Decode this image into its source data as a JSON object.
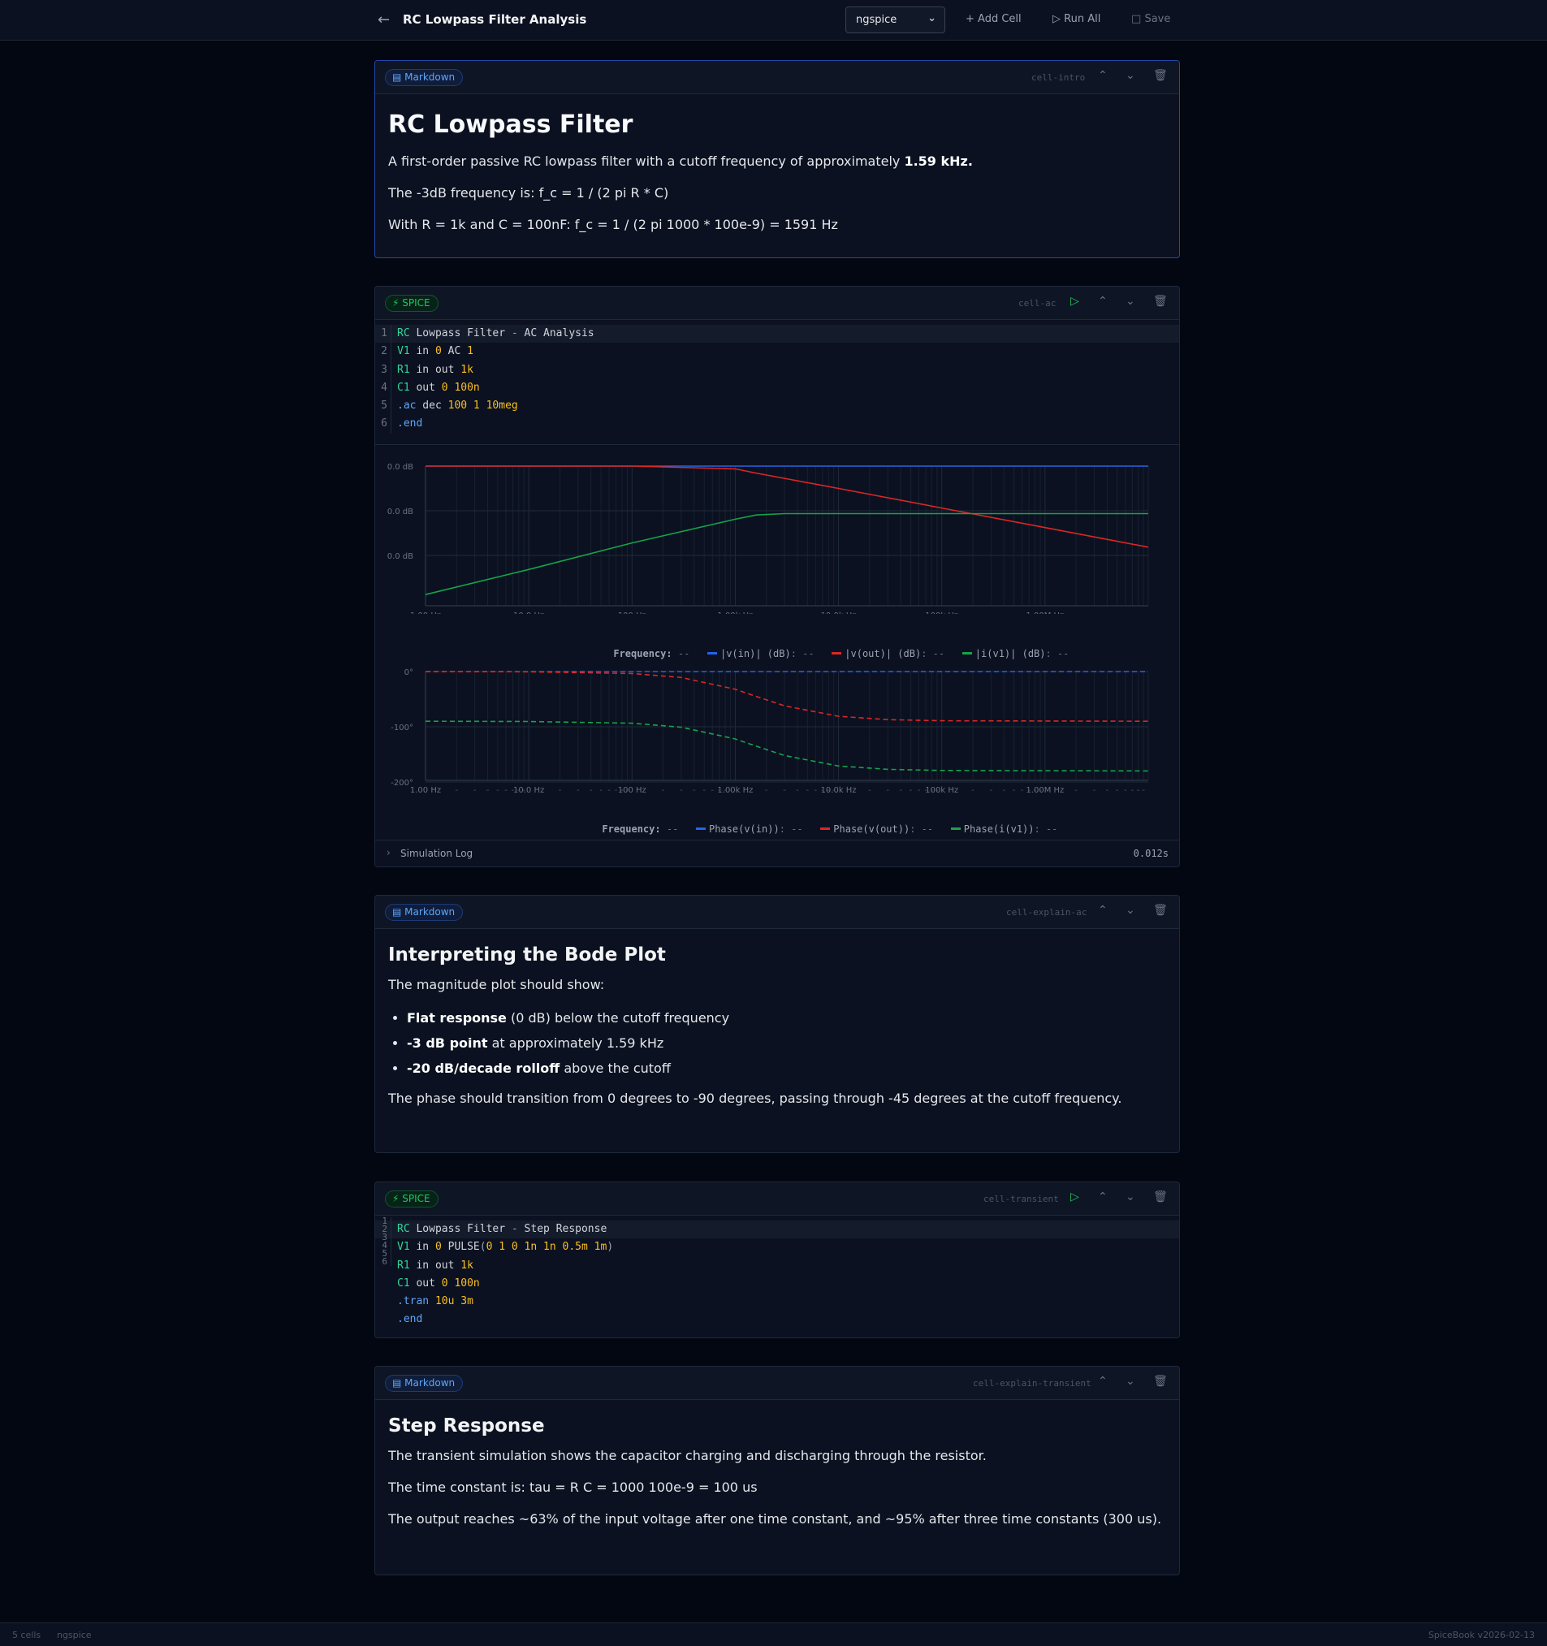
{
  "header": {
    "back_icon": "arrow-left-icon",
    "title": "RC Lowpass Filter Analysis",
    "engine_select": "ngspice",
    "add_cell": "Add Cell",
    "run_all": "Run All",
    "save": "Save"
  },
  "cells": {
    "intro": {
      "type": "Markdown",
      "id": "cell-intro",
      "h1": "RC Lowpass Filter",
      "p1_pre": "A first-order passive RC lowpass filter with a cutoff frequency of approximately ",
      "p1_bold": "1.59 kHz.",
      "p2": "The -3dB frequency is: f_c = 1 / (2 pi R * C)",
      "p3": "With R = 1k and C = 100nF: f_c = 1 / (2 pi 1000 * 100e-9) = 1591 Hz"
    },
    "ac": {
      "type": "SPICE",
      "id": "cell-ac",
      "line_numbers": [
        "1",
        "2",
        "3",
        "4",
        "5",
        "6"
      ],
      "code": {
        "l1": [
          "RC",
          " Lowpass Filter ",
          "-",
          " AC Analysis"
        ],
        "l2": [
          "V1",
          " in ",
          "0",
          " AC ",
          "1"
        ],
        "l3": [
          "R1",
          " in out ",
          "1k"
        ],
        "l4": [
          "C1",
          " out ",
          "0",
          " ",
          "100n"
        ],
        "l5": [
          ".ac",
          " dec ",
          "100 1 10meg"
        ],
        "l6": [
          ".end"
        ]
      },
      "log_label": "Simulation Log",
      "duration": "0.012s"
    },
    "explain_ac": {
      "type": "Markdown",
      "id": "cell-explain-ac",
      "h2": "Interpreting the Bode Plot",
      "intro": "The magnitude plot should show:",
      "bullets": [
        {
          "bold": "Flat response",
          "rest": " (0 dB) below the cutoff frequency"
        },
        {
          "bold": "-3 dB point",
          "rest": " at approximately 1.59 kHz"
        },
        {
          "bold": "-20 dB/decade rolloff",
          "rest": " above the cutoff"
        }
      ],
      "outro": "The phase should transition from 0 degrees to -90 degrees, passing through -45 degrees at the cutoff frequency."
    },
    "transient": {
      "type": "SPICE",
      "id": "cell-transient",
      "line_numbers": [
        "1",
        "2",
        "3",
        "4",
        "5",
        "6"
      ],
      "code": {
        "l1": [
          "RC",
          " Lowpass Filter ",
          "-",
          " Step Response"
        ],
        "l2": [
          "V1",
          " in ",
          "0",
          " PULSE",
          "(",
          "0 1 0 1n 1n 0.5m 1m",
          ")"
        ],
        "l3": [
          "R1",
          " in out ",
          "1k"
        ],
        "l4": [
          "C1",
          " out ",
          "0",
          " ",
          "100n"
        ],
        "l5": [
          ".tran",
          " ",
          "10u 3m"
        ],
        "l6": [
          ".end"
        ]
      }
    },
    "explain_transient": {
      "type": "Markdown",
      "id": "cell-explain-transient",
      "h2": "Step Response",
      "p1": "The transient simulation shows the capacitor charging and discharging through the resistor.",
      "p2": "The time constant is: tau = R C = 1000 100e-9 = 100 us",
      "p3": "The output reaches ~63% of the input voltage after one time constant, and ~95% after three time constants (300 us)."
    }
  },
  "chart_data": [
    {
      "type": "line",
      "x_scale": "log",
      "x_ticks": [
        "1.00 Hz",
        "10.0 Hz",
        "100 Hz",
        "1.00k Hz",
        "10.0k Hz",
        "100k Hz",
        "1.00M Hz"
      ],
      "x_range": [
        1,
        10000000
      ],
      "y_ticks": [
        "0.0 dB",
        "0.0 dB",
        "0.0 dB"
      ],
      "legend": {
        "x_label": "Frequency:",
        "x_value": "--",
        "series_values": [
          "--",
          "--",
          "--"
        ]
      },
      "series": [
        {
          "name": "|v(in)| (dB)",
          "color": "#2563eb",
          "style": "solid",
          "x": [
            1,
            10000000
          ],
          "y_frac": [
            0.0,
            0.0
          ]
        },
        {
          "name": "|v(out)| (dB)",
          "color": "#dc2626",
          "style": "solid",
          "x": [
            1,
            100,
            1000,
            1591,
            10000,
            100000,
            1000000,
            10000000
          ],
          "y_frac": [
            0.0,
            0.0,
            0.02,
            0.05,
            0.16,
            0.3,
            0.44,
            0.58
          ]
        },
        {
          "name": "|i(v1)| (dB)",
          "color": "#16a34a",
          "style": "solid",
          "x": [
            1,
            10,
            100,
            1000,
            1591,
            3000,
            10000000
          ],
          "y_frac": [
            0.92,
            0.74,
            0.55,
            0.38,
            0.35,
            0.34,
            0.34
          ]
        }
      ]
    },
    {
      "type": "line",
      "x_scale": "log",
      "x_ticks": [
        "1.00 Hz",
        "10.0 Hz",
        "100 Hz",
        "1.00k Hz",
        "10.0k Hz",
        "100k Hz",
        "1.00M Hz"
      ],
      "x_range": [
        1,
        10000000
      ],
      "y_ticks": [
        "0°",
        "-100°",
        "-200°"
      ],
      "y_range": [
        -200,
        0
      ],
      "legend": {
        "x_label": "Frequency:",
        "x_value": "--",
        "series_values": [
          "--",
          "--",
          "--"
        ]
      },
      "series": [
        {
          "name": "Phase(v(in))",
          "color": "#2563eb",
          "style": "dashed",
          "x": [
            1,
            10000000
          ],
          "y": [
            0,
            0
          ]
        },
        {
          "name": "Phase(v(out))",
          "color": "#dc2626",
          "style": "dashed",
          "x": [
            1,
            10,
            100,
            300,
            1000,
            1591,
            3000,
            10000,
            30000,
            100000,
            10000000
          ],
          "y": [
            0,
            -0.4,
            -3.6,
            -10.7,
            -32,
            -45,
            -62,
            -81,
            -87,
            -89.1,
            -90
          ]
        },
        {
          "name": "Phase(i(v1))",
          "color": "#16a34a",
          "style": "dashed",
          "x": [
            1,
            10,
            100,
            300,
            1000,
            1591,
            3000,
            10000,
            30000,
            100000,
            10000000
          ],
          "y": [
            -90,
            -90.4,
            -93.6,
            -100.7,
            -122,
            -135,
            -152,
            -171,
            -177,
            -179.1,
            -180
          ]
        }
      ]
    }
  ],
  "status": {
    "cells": "5 cells",
    "engine": "ngspice",
    "version": "SpiceBook v2026-02-13"
  }
}
